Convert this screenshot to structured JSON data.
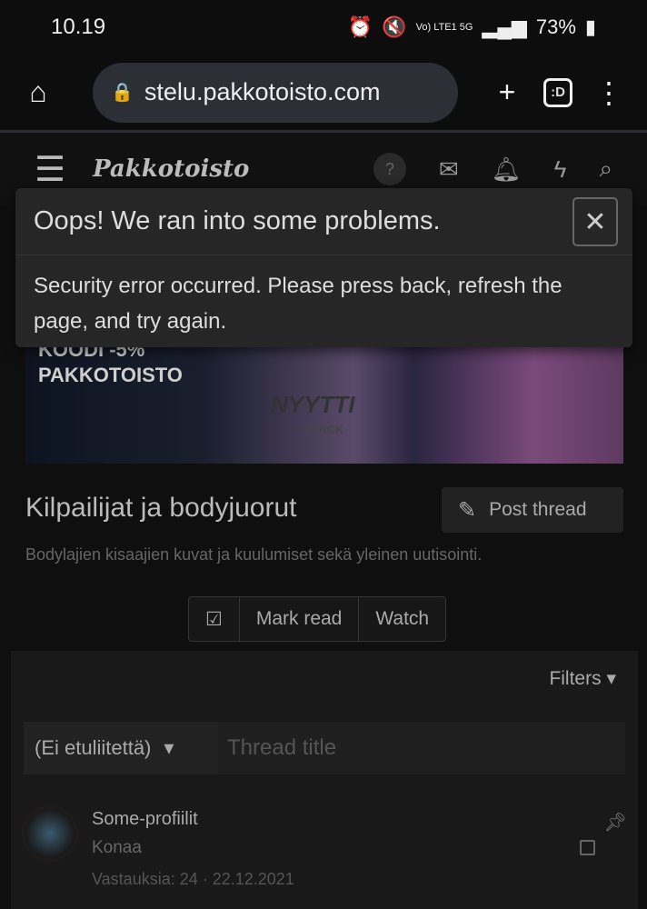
{
  "status_bar": {
    "time": "10.19",
    "network": "Vo) LTE1 5G",
    "battery": "73%"
  },
  "browser": {
    "url": "stelu.pakkotoisto.com",
    "tabs_label": ":D"
  },
  "site": {
    "logo": "Pakkotoisto",
    "help": "?"
  },
  "banner": {
    "line1": "KOODI -5%",
    "line2": "PAKKOTOISTO",
    "product": "NYYTTI",
    "product_sub": "BLACK"
  },
  "modal": {
    "title": "Oops! We ran into some problems.",
    "message": "Security error occurred. Please press back, refresh the page, and try again.",
    "close": "✕"
  },
  "forum": {
    "title": "Kilpailijat ja bodyjuorut",
    "description": "Bodylajien kisaajien kuvat ja kuulumiset sekä yleinen uutisointi.",
    "post_thread": "Post thread",
    "mark_read": "Mark read",
    "watch": "Watch"
  },
  "filters": {
    "label": "Filters",
    "prefix": "(Ei etuliitettä)",
    "title_placeholder": "Thread title"
  },
  "threads": [
    {
      "title": "Some-profiilit",
      "author": "Konaa",
      "meta": "Vastauksia: 24 · 22.12.2021"
    }
  ]
}
